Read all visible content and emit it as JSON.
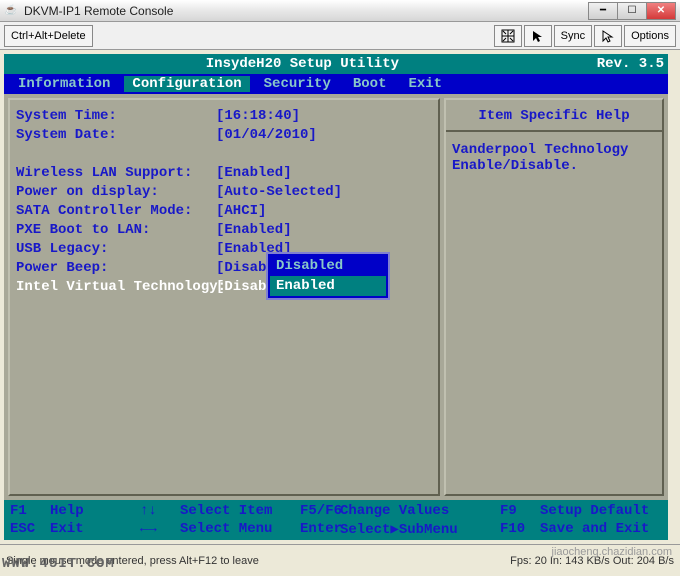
{
  "window": {
    "title": "DKVM-IP1 Remote Console",
    "buttons": {
      "ctrl_alt_del": "Ctrl+Alt+Delete",
      "sync": "Sync",
      "options": "Options"
    }
  },
  "bios": {
    "header_title": "InsydeH20 Setup Utility",
    "revision": "Rev. 3.5",
    "menu": [
      "Information",
      "Configuration",
      "Security",
      "Boot",
      "Exit"
    ],
    "menu_active_index": 1,
    "settings": [
      {
        "label": "System Time:",
        "value": "[16:18:40]"
      },
      {
        "label": "System Date:",
        "value": "[01/04/2010]"
      },
      {
        "label": "",
        "value": ""
      },
      {
        "label": "Wireless LAN Support:",
        "value": "[Enabled]"
      },
      {
        "label": "Power on display:",
        "value": "[Auto-Selected]"
      },
      {
        "label": "SATA Controller Mode:",
        "value": "[AHCI]"
      },
      {
        "label": "PXE Boot to LAN:",
        "value": "[Enabled]"
      },
      {
        "label": "USB Legacy:",
        "value": "[Enabled]"
      },
      {
        "label": "Power Beep:",
        "value": "[Disabled]"
      },
      {
        "label": "Intel Virtual Technology:",
        "value": "[Disabled]",
        "selected": true
      }
    ],
    "popup": {
      "options": [
        "Disabled",
        "Enabled"
      ],
      "selected_index": 1
    },
    "help": {
      "title": "Item Specific Help",
      "text": "Vanderpool Technology Enable/Disable."
    },
    "hints": [
      [
        {
          "key": "F1",
          "act": "Help"
        },
        {
          "key": "↑↓",
          "act": "Select Item"
        },
        {
          "key": "F5/F6",
          "act": "Change Values"
        },
        {
          "key": "F9",
          "act": "Setup Default"
        }
      ],
      [
        {
          "key": "ESC",
          "act": "Exit"
        },
        {
          "key": "←→",
          "act": "Select Menu"
        },
        {
          "key": "Enter",
          "act": "Select▶SubMenu"
        },
        {
          "key": "F10",
          "act": "Save and Exit"
        }
      ]
    ]
  },
  "status": {
    "left": "Single mouse mode entered, press Alt+F12 to leave",
    "right": "Fps: 20 In: 143 KB/s Out: 204 B/s"
  },
  "watermark": "WWW.45IT.COM",
  "watermark2": "jiaocheng.chazidian.com"
}
